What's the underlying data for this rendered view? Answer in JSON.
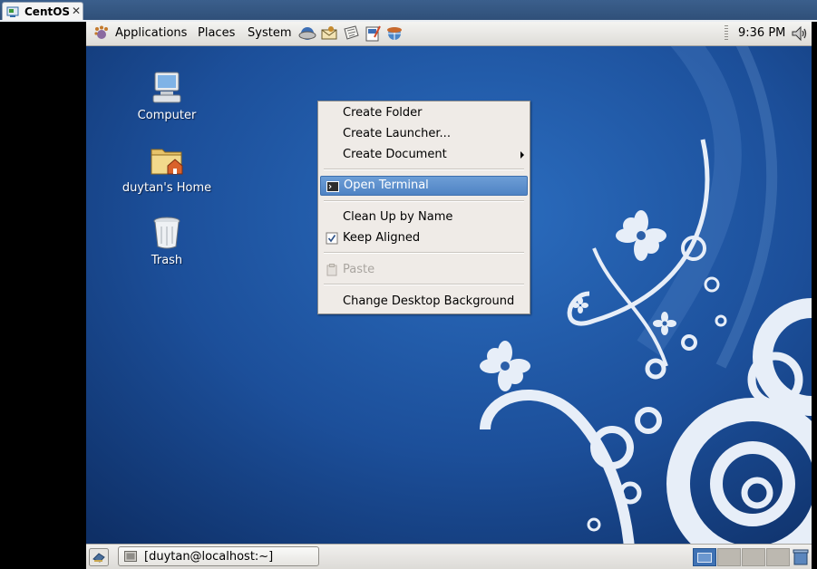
{
  "host": {
    "tab_title": "CentOS",
    "close_glyph": "✕"
  },
  "top_panel": {
    "menus": [
      "Applications",
      "Places",
      "System"
    ],
    "launchers": [
      "web-browser-icon",
      "email-client-icon",
      "notes-icon",
      "document-editor-icon",
      "network-icon"
    ],
    "clock": "9:36 PM",
    "volume_icon": "volume-icon"
  },
  "desktop": {
    "icons": [
      {
        "label": "Computer",
        "icon": "computer-icon"
      },
      {
        "label": "duytan's Home",
        "icon": "home-folder-icon"
      },
      {
        "label": "Trash",
        "icon": "trash-icon"
      }
    ]
  },
  "context_menu": {
    "items": [
      {
        "label": "Create Folder",
        "state": "normal"
      },
      {
        "label": "Create Launcher...",
        "state": "normal"
      },
      {
        "label": "Create Document",
        "state": "normal",
        "submenu": true
      },
      {
        "label": "Open Terminal",
        "state": "highlighted",
        "icon": "terminal-icon"
      },
      {
        "label": "Clean Up by Name",
        "state": "normal"
      },
      {
        "label": "Keep Aligned",
        "state": "normal",
        "checked": true
      },
      {
        "label": "Paste",
        "state": "disabled",
        "icon": "paste-icon"
      },
      {
        "label": "Change Desktop Background",
        "state": "normal"
      }
    ]
  },
  "bottom_panel": {
    "task_label": "[duytan@localhost:~]",
    "workspaces": 4,
    "active_workspace": 1
  },
  "colors": {
    "wallpaper": "#1f56a5",
    "highlight": "#4f83c4"
  }
}
